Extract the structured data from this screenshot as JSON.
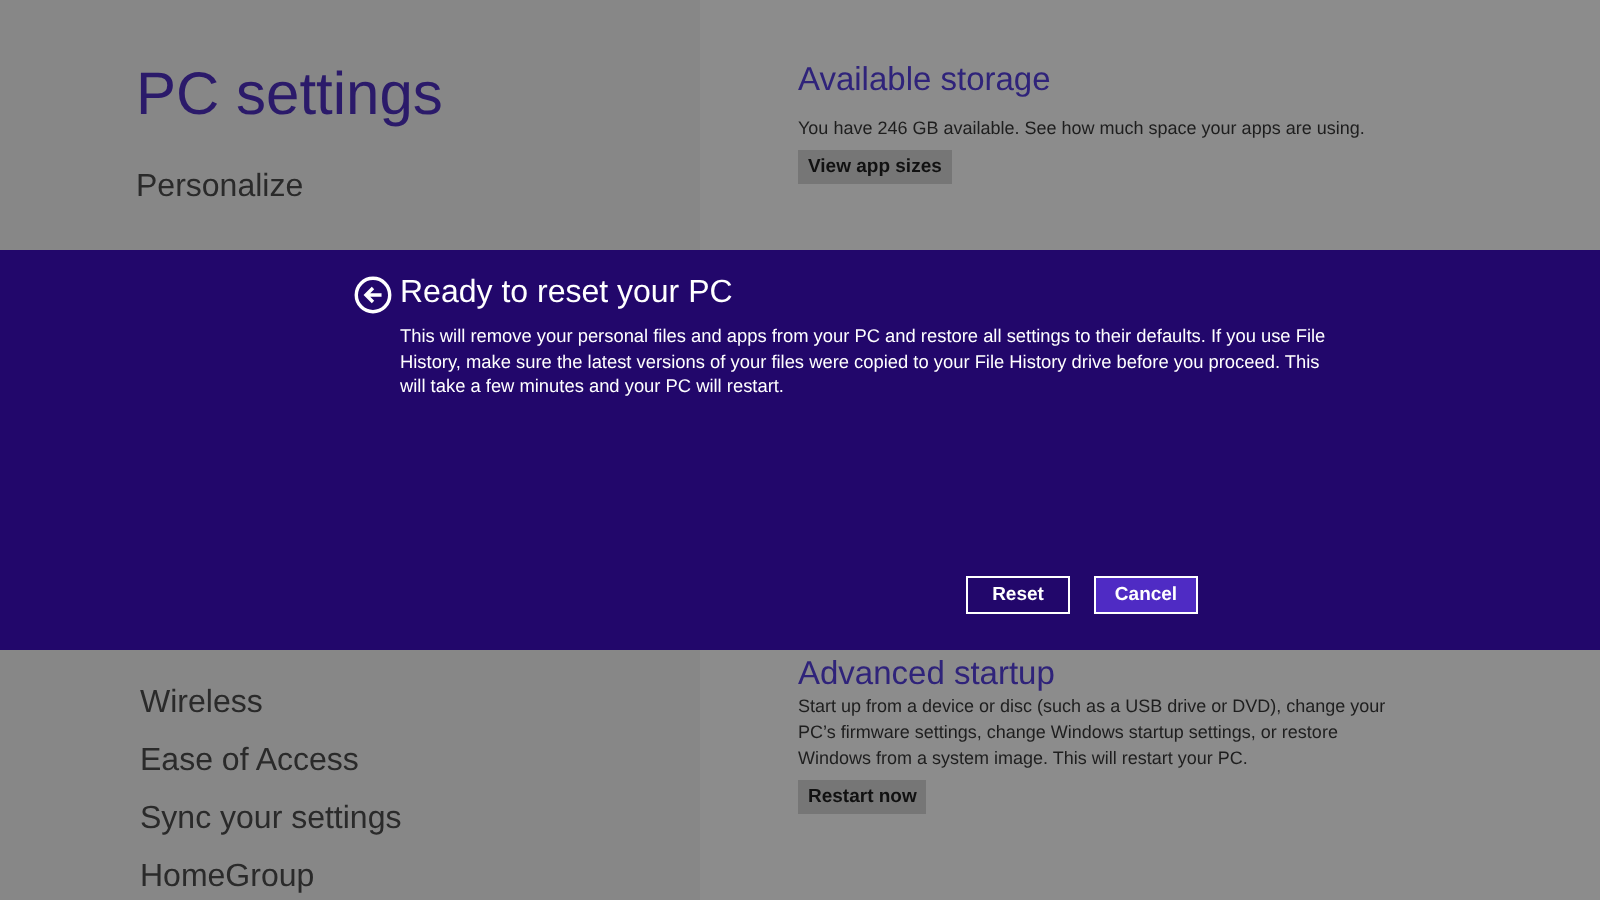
{
  "nav": {
    "title": "PC settings",
    "items_top": [
      {
        "label": "Personalize"
      }
    ],
    "items_bottom": [
      {
        "label": "Wireless"
      },
      {
        "label": "Ease of Access"
      },
      {
        "label": "Sync your settings"
      },
      {
        "label": "HomeGroup"
      }
    ]
  },
  "content": {
    "sections_top": [
      {
        "heading": "Available storage",
        "text": "You have 246 GB available. See how much space your apps are using.",
        "button": "View app sizes"
      }
    ],
    "sections_bottom": [
      {
        "heading": "Advanced startup",
        "text": "Start up from a device or disc (such as a USB drive or DVD), change your PC’s firmware settings, change Windows startup settings, or restore Windows from a system image. This will restart your PC.",
        "button": "Restart now"
      }
    ]
  },
  "dialog": {
    "title": "Ready to reset your PC",
    "message": "This will remove your personal files and apps from your PC and restore all settings to their defaults. If you use File History, make sure the latest versions of your files were copied to your File History drive before you proceed. This will take a few minutes and your PC will restart.",
    "buttons": [
      {
        "label": "Reset",
        "kind": "secondary"
      },
      {
        "label": "Cancel",
        "kind": "primary"
      }
    ]
  }
}
